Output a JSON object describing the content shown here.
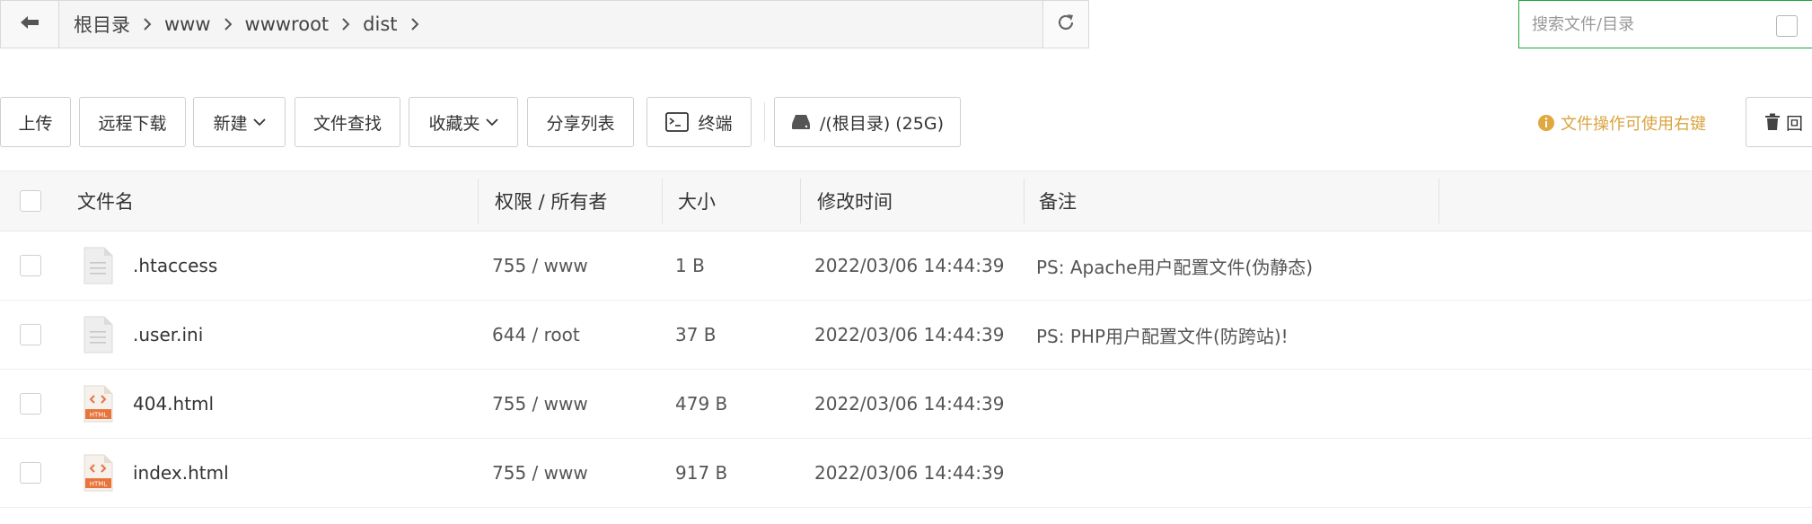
{
  "address_bar": {
    "crumbs": [
      "根目录",
      "www",
      "wwwroot",
      "dist"
    ]
  },
  "search": {
    "placeholder": "搜索文件/目录"
  },
  "toolbar": {
    "upload": "上传",
    "remote_download": "远程下载",
    "new": "新建",
    "file_search": "文件查找",
    "favorites": "收藏夹",
    "share_list": "分享列表",
    "terminal": "终端",
    "disk": "/(根目录) (25G)",
    "tip": "文件操作可使用右键",
    "recycle": "回收站",
    "recycle_visible": "回"
  },
  "table": {
    "headers": {
      "name": "文件名",
      "permission": "权限 / 所有者",
      "size": "大小",
      "modified": "修改时间",
      "note": "备注"
    },
    "rows": [
      {
        "name": ".htaccess",
        "permission": "755 / www",
        "size": "1 B",
        "modified": "2022/03/06 14:44:39",
        "note": "PS: Apache用户配置文件(伪静态)",
        "icon": "text-file-icon"
      },
      {
        "name": ".user.ini",
        "permission": "644 / root",
        "size": "37 B",
        "modified": "2022/03/06 14:44:39",
        "note": "PS: PHP用户配置文件(防跨站)!",
        "icon": "text-file-icon"
      },
      {
        "name": "404.html",
        "permission": "755 / www",
        "size": "479 B",
        "modified": "2022/03/06 14:44:39",
        "note": "",
        "icon": "html-file-icon"
      },
      {
        "name": "index.html",
        "permission": "755 / www",
        "size": "917 B",
        "modified": "2022/03/06 14:44:39",
        "note": "",
        "icon": "html-file-icon"
      }
    ]
  },
  "colors": {
    "accent_green": "#20a53a",
    "tip_gold": "#d9a441",
    "html_icon_orange": "#e8743b"
  }
}
